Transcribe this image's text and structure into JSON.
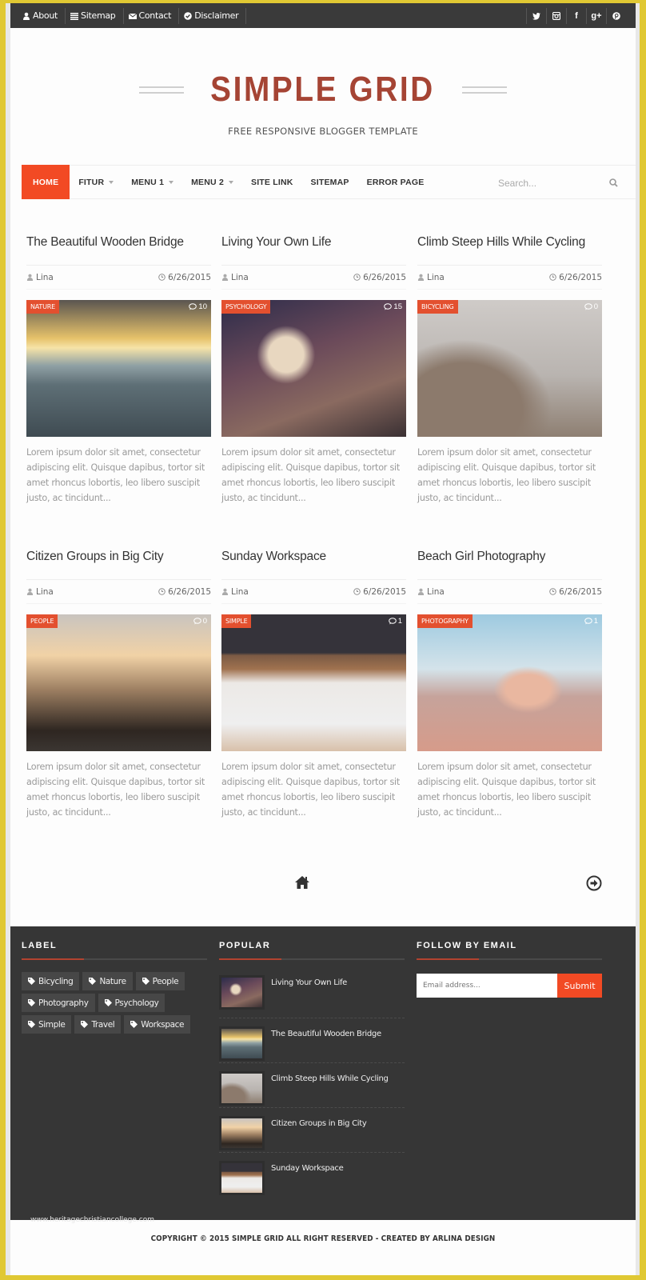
{
  "topbar": {
    "links": [
      {
        "label": "About",
        "icon": "user-icon"
      },
      {
        "label": "Sitemap",
        "icon": "list-icon"
      },
      {
        "label": "Contact",
        "icon": "envelope-icon"
      },
      {
        "label": "Disclaimer",
        "icon": "check-circle-icon"
      }
    ],
    "social": [
      {
        "name": "twitter",
        "glyph": "🐦"
      },
      {
        "name": "instagram",
        "glyph": "◙"
      },
      {
        "name": "facebook",
        "glyph": "f"
      },
      {
        "name": "google-plus",
        "glyph": "g+"
      },
      {
        "name": "pinterest",
        "glyph": "℗"
      }
    ]
  },
  "header": {
    "title": "SIMPLE GRID",
    "tagline": "FREE RESPONSIVE BLOGGER TEMPLATE"
  },
  "nav": {
    "items": [
      {
        "label": "HOME",
        "active": true,
        "dropdown": false
      },
      {
        "label": "FITUR",
        "active": false,
        "dropdown": true
      },
      {
        "label": "MENU 1",
        "active": false,
        "dropdown": true
      },
      {
        "label": "MENU 2",
        "active": false,
        "dropdown": true
      },
      {
        "label": "SITE LINK",
        "active": false,
        "dropdown": false
      },
      {
        "label": "SITEMAP",
        "active": false,
        "dropdown": false
      },
      {
        "label": "ERROR PAGE",
        "active": false,
        "dropdown": false
      }
    ],
    "search_placeholder": "Search..."
  },
  "posts": [
    {
      "title": "The Beautiful Wooden Bridge",
      "author": "Lina",
      "date": "6/26/2015",
      "category": "NATURE",
      "comments": "10",
      "excerpt": "Lorem ipsum dolor sit amet, consectetur adipiscing elit. Quisque dapibus, tortor sit amet rhoncus lobortis, leo libero suscipit justo, ac tincidunt...",
      "image": "img-bridge"
    },
    {
      "title": "Living Your Own Life",
      "author": "Lina",
      "date": "6/26/2015",
      "category": "PSYCHOLOGY",
      "comments": "15",
      "excerpt": "Lorem ipsum dolor sit amet, consectetur adipiscing elit. Quisque dapibus, tortor sit amet rhoncus lobortis, leo libero suscipit justo, ac tincidunt...",
      "image": "img-life"
    },
    {
      "title": "Climb Steep Hills While Cycling",
      "author": "Lina",
      "date": "6/26/2015",
      "category": "BICYCLING",
      "comments": "0",
      "excerpt": "Lorem ipsum dolor sit amet, consectetur adipiscing elit. Quisque dapibus, tortor sit amet rhoncus lobortis, leo libero suscipit justo, ac tincidunt...",
      "image": "img-cycling"
    },
    {
      "title": "Citizen Groups in Big City",
      "author": "Lina",
      "date": "6/26/2015",
      "category": "PEOPLE",
      "comments": "0",
      "excerpt": "Lorem ipsum dolor sit amet, consectetur adipiscing elit. Quisque dapibus, tortor sit amet rhoncus lobortis, leo libero suscipit justo, ac tincidunt...",
      "image": "img-city"
    },
    {
      "title": "Sunday Workspace",
      "author": "Lina",
      "date": "6/26/2015",
      "category": "SIMPLE",
      "comments": "1",
      "excerpt": "Lorem ipsum dolor sit amet, consectetur adipiscing elit. Quisque dapibus, tortor sit amet rhoncus lobortis, leo libero suscipit justo, ac tincidunt...",
      "image": "img-workspace"
    },
    {
      "title": "Beach Girl Photography",
      "author": "Lina",
      "date": "6/26/2015",
      "category": "PHOTOGRAPHY",
      "comments": "1",
      "excerpt": "Lorem ipsum dolor sit amet, consectetur adipiscing elit. Quisque dapibus, tortor sit amet rhoncus lobortis, leo libero suscipit justo, ac tincidunt...",
      "image": "img-beach"
    }
  ],
  "footer": {
    "label_title": "LABEL",
    "labels": [
      "Bicycling",
      "Nature",
      "People",
      "Photography",
      "Psychology",
      "Simple",
      "Travel",
      "Workspace"
    ],
    "popular_title": "POPULAR",
    "popular": [
      {
        "title": "Living Your Own Life",
        "image": "img-life"
      },
      {
        "title": "The Beautiful Wooden Bridge",
        "image": "img-bridge"
      },
      {
        "title": "Climb Steep Hills While Cycling",
        "image": "img-cycling"
      },
      {
        "title": "Citizen Groups in Big City",
        "image": "img-city"
      },
      {
        "title": "Sunday Workspace",
        "image": "img-workspace"
      }
    ],
    "follow_title": "FOLLOW BY EMAIL",
    "email_placeholder": "Email address...",
    "submit_label": "Submit"
  },
  "watermark": "www.heritagechristiancollege.com",
  "copyright": "COPYRIGHT © 2015 SIMPLE GRID ALL RIGHT RESERVED - CREATED BY ARLINA DESIGN",
  "colors": {
    "accent": "#f24a24",
    "brand": "#a54434",
    "topbar": "#3a3a3a",
    "footer": "#363636"
  }
}
